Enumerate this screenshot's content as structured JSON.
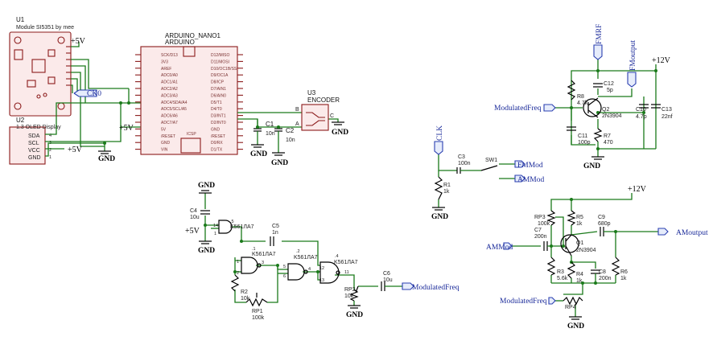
{
  "u1": {
    "ref": "U1",
    "name": "Module SI5351 by mee"
  },
  "nano": {
    "name": "ARDUINO_NANO1",
    "sub": "ARDUINO",
    "left_pins": [
      "SCK/D13",
      "3V3",
      "AREF",
      "ADC0/A0",
      "ADC1/A1",
      "ADC2/A2",
      "ADC3/A3",
      "ADC4/SDA/A4",
      "ADC5/SCL/A5",
      "ADC6/A6",
      "ADC7/A7",
      "5V",
      "/RESET",
      "GND",
      "VIN"
    ],
    "right_pins": [
      "D12/MISO",
      "D11/MOSI",
      "D10/OC1B/SS",
      "D9/OC1A",
      "D8/ICP",
      "D7/AIN1",
      "D6/AIN0",
      "D5/T1",
      "D4/T0",
      "D3/INT1",
      "D2/INT0",
      "GND",
      "/RESET",
      "D0/RX",
      "D1/TX"
    ],
    "icsp": "ICSP"
  },
  "u2": {
    "ref": "U2",
    "name": "1.3 OLED Display",
    "pins": [
      "SDA",
      "SCL",
      "VCC",
      "GND"
    ],
    "pin_nums": [
      "4",
      "3",
      "2",
      "1"
    ]
  },
  "u3": {
    "ref": "U3",
    "name": "ENCODER",
    "pins": [
      "B",
      "A",
      "C"
    ]
  },
  "nets": {
    "vcc5": "+5V",
    "vcc12": "+12V",
    "gnd": "GND",
    "ck0": "CK0",
    "clk": "CLK",
    "fmrf": "FMRF",
    "fmoutput": "FMoutput",
    "modulatedfreq": "ModulatedFreq",
    "fmmod": "FMMod",
    "ammod": "AMMod",
    "amoutput": "AMoutput"
  },
  "parts": {
    "c1": [
      "C1",
      "10n"
    ],
    "c2": [
      "C2",
      "10n"
    ],
    "c3": [
      "C3",
      "100n"
    ],
    "c4": [
      "C4",
      "10u"
    ],
    "c5": [
      "C5",
      "1n"
    ],
    "c6": [
      "C6",
      "10u"
    ],
    "c7": [
      "C7",
      "200n"
    ],
    "c8": [
      "C8",
      "200n"
    ],
    "c9": [
      "C9",
      "680p"
    ],
    "c10": [
      "C10",
      "4.7p"
    ],
    "c11": [
      "C11",
      "100p"
    ],
    "c12": [
      "C12",
      "5p"
    ],
    "c13": [
      "C13",
      "22nf"
    ],
    "r1": [
      "R1",
      "1k"
    ],
    "r2": [
      "R2",
      "10k"
    ],
    "r3": [
      "R3",
      "5.6k"
    ],
    "r4": [
      "R4",
      "1k"
    ],
    "r5": [
      "R5",
      "1k"
    ],
    "r6": [
      "R6",
      "1k"
    ],
    "r7": [
      "R7",
      "470"
    ],
    "r8": [
      "R8",
      "4.7k"
    ],
    "rp1": [
      "RP1",
      "100k"
    ],
    "rp2": [
      "RP2",
      "10k"
    ],
    "rp3": [
      "RP3",
      "100k"
    ],
    "rp4": [
      "RP4"
    ],
    "q1": [
      "Q1",
      "2N3904"
    ],
    "q2": [
      "Q2",
      "2N3904"
    ],
    "sw1": [
      "SW1"
    ]
  },
  "gates": {
    "ic": "K561ЛА7",
    "u1": ".1",
    "u2": ".2",
    "u4": ".4",
    "u5": ".5",
    "pins": {
      "g1a": "1",
      "g1b": "2",
      "g1o": "3",
      "g2a": "5",
      "g2b": "6",
      "g2o": "4",
      "g4a": "12",
      "g4b": "13",
      "g4o": "11",
      "g5a": "14",
      "g5b": "1"
    }
  }
}
